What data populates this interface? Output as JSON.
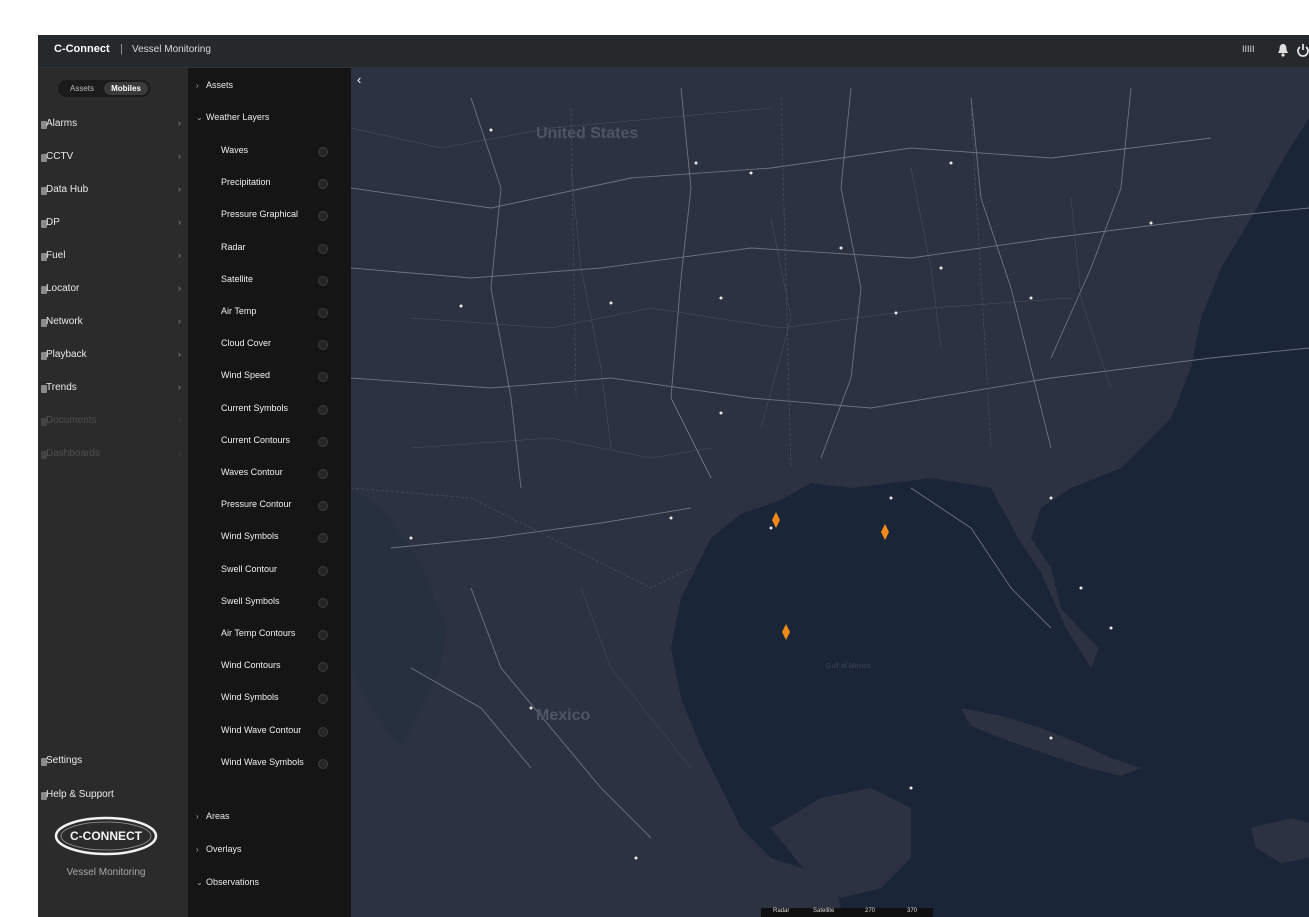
{
  "app": {
    "brand": "C-Connect",
    "separator": "|",
    "section": "Vessel Monitoring",
    "user_initials": "IIIII"
  },
  "nav": {
    "toggle": [
      "Assets",
      "Mobiles"
    ],
    "items": [
      {
        "label": "Alarms"
      },
      {
        "label": "CCTV"
      },
      {
        "label": "Data Hub"
      },
      {
        "label": "DP"
      },
      {
        "label": "Fuel"
      },
      {
        "label": "Locator"
      },
      {
        "label": "Network"
      },
      {
        "label": "Playback"
      },
      {
        "label": "Trends"
      },
      {
        "label": "Documents"
      },
      {
        "label": "Dashboards"
      }
    ],
    "settings": "Settings",
    "help": "Help & Support"
  },
  "brand_logo": {
    "text": "C-CONNECT",
    "subtitle": "Vessel Monitoring"
  },
  "layers": {
    "sections": [
      "Assets",
      "Weather Layers",
      "Areas",
      "Overlays",
      "Observations"
    ],
    "weather_items": [
      "Waves",
      "Precipitation",
      "Pressure Graphical",
      "Radar",
      "Satellite",
      "Air Temp",
      "Cloud Cover",
      "Wind Speed",
      "Current Symbols",
      "Current Contours",
      "Waves Contour",
      "Pressure Contour",
      "Wind Symbols",
      "Swell Contour",
      "Swell Symbols",
      "Air Temp Contours",
      "Wind Contours",
      "Wind Symbols",
      "Wind Wave Contour",
      "Wind Wave Symbols"
    ]
  },
  "map": {
    "labels": {
      "usa": "United States",
      "mexico": "Mexico",
      "gulf": "Gulf of Mexico"
    },
    "scale": [
      "Radar",
      "Satellite",
      "270",
      "370"
    ],
    "water_color": "#1b2538",
    "land_color": "#2b3140",
    "vessel_color": "#f08a1a"
  }
}
